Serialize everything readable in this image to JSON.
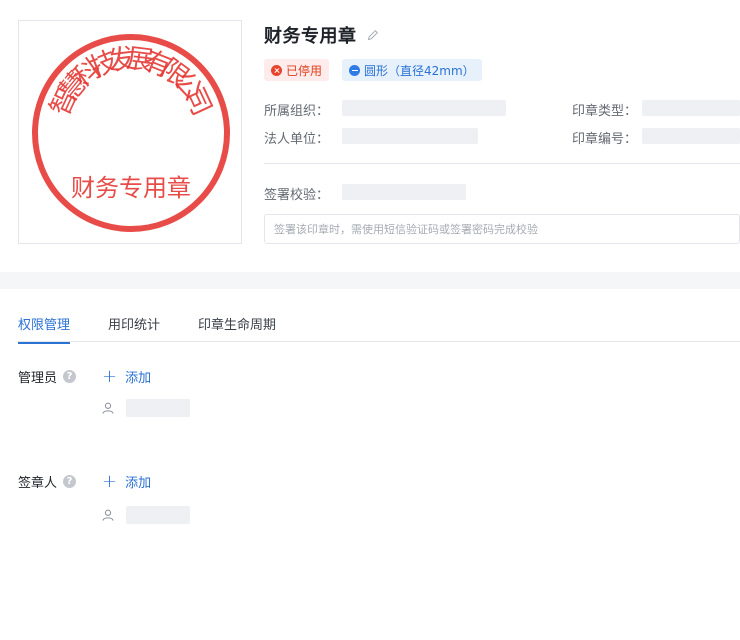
{
  "seal": {
    "arc_text": [
      "智",
      "慧",
      "科",
      "技",
      "发",
      "展",
      "有",
      "限",
      "公",
      "司"
    ],
    "bottom_text": "财务专用章",
    "color": "#e53935"
  },
  "header": {
    "title": "财务专用章",
    "edit_icon": "pencil-icon"
  },
  "tags": {
    "status": "已停用",
    "status_icon": "close-circle-icon",
    "shape": "圆形（直径42mm）",
    "shape_icon": "minus-circle-icon"
  },
  "fields": {
    "org_label": "所属组织：",
    "seal_type_label": "印章类型：",
    "legal_entity_label": "法人单位：",
    "seal_number_label": "印章编号：",
    "sign_check_label": "签署校验："
  },
  "hint": "签署该印章时，需使用短信验证码或签署密码完成校验",
  "tabs": [
    {
      "label": "权限管理",
      "active": true
    },
    {
      "label": "用印统计",
      "active": false
    },
    {
      "label": "印章生命周期",
      "active": false
    }
  ],
  "sections": {
    "admins_label": "管理员",
    "signers_label": "签章人",
    "add_label": "添加",
    "help_icon": "question-circle-icon",
    "user_icon": "user-icon"
  },
  "colors": {
    "accent": "#2a72d4",
    "danger": "#e0401d",
    "seal_red": "#e53935"
  }
}
